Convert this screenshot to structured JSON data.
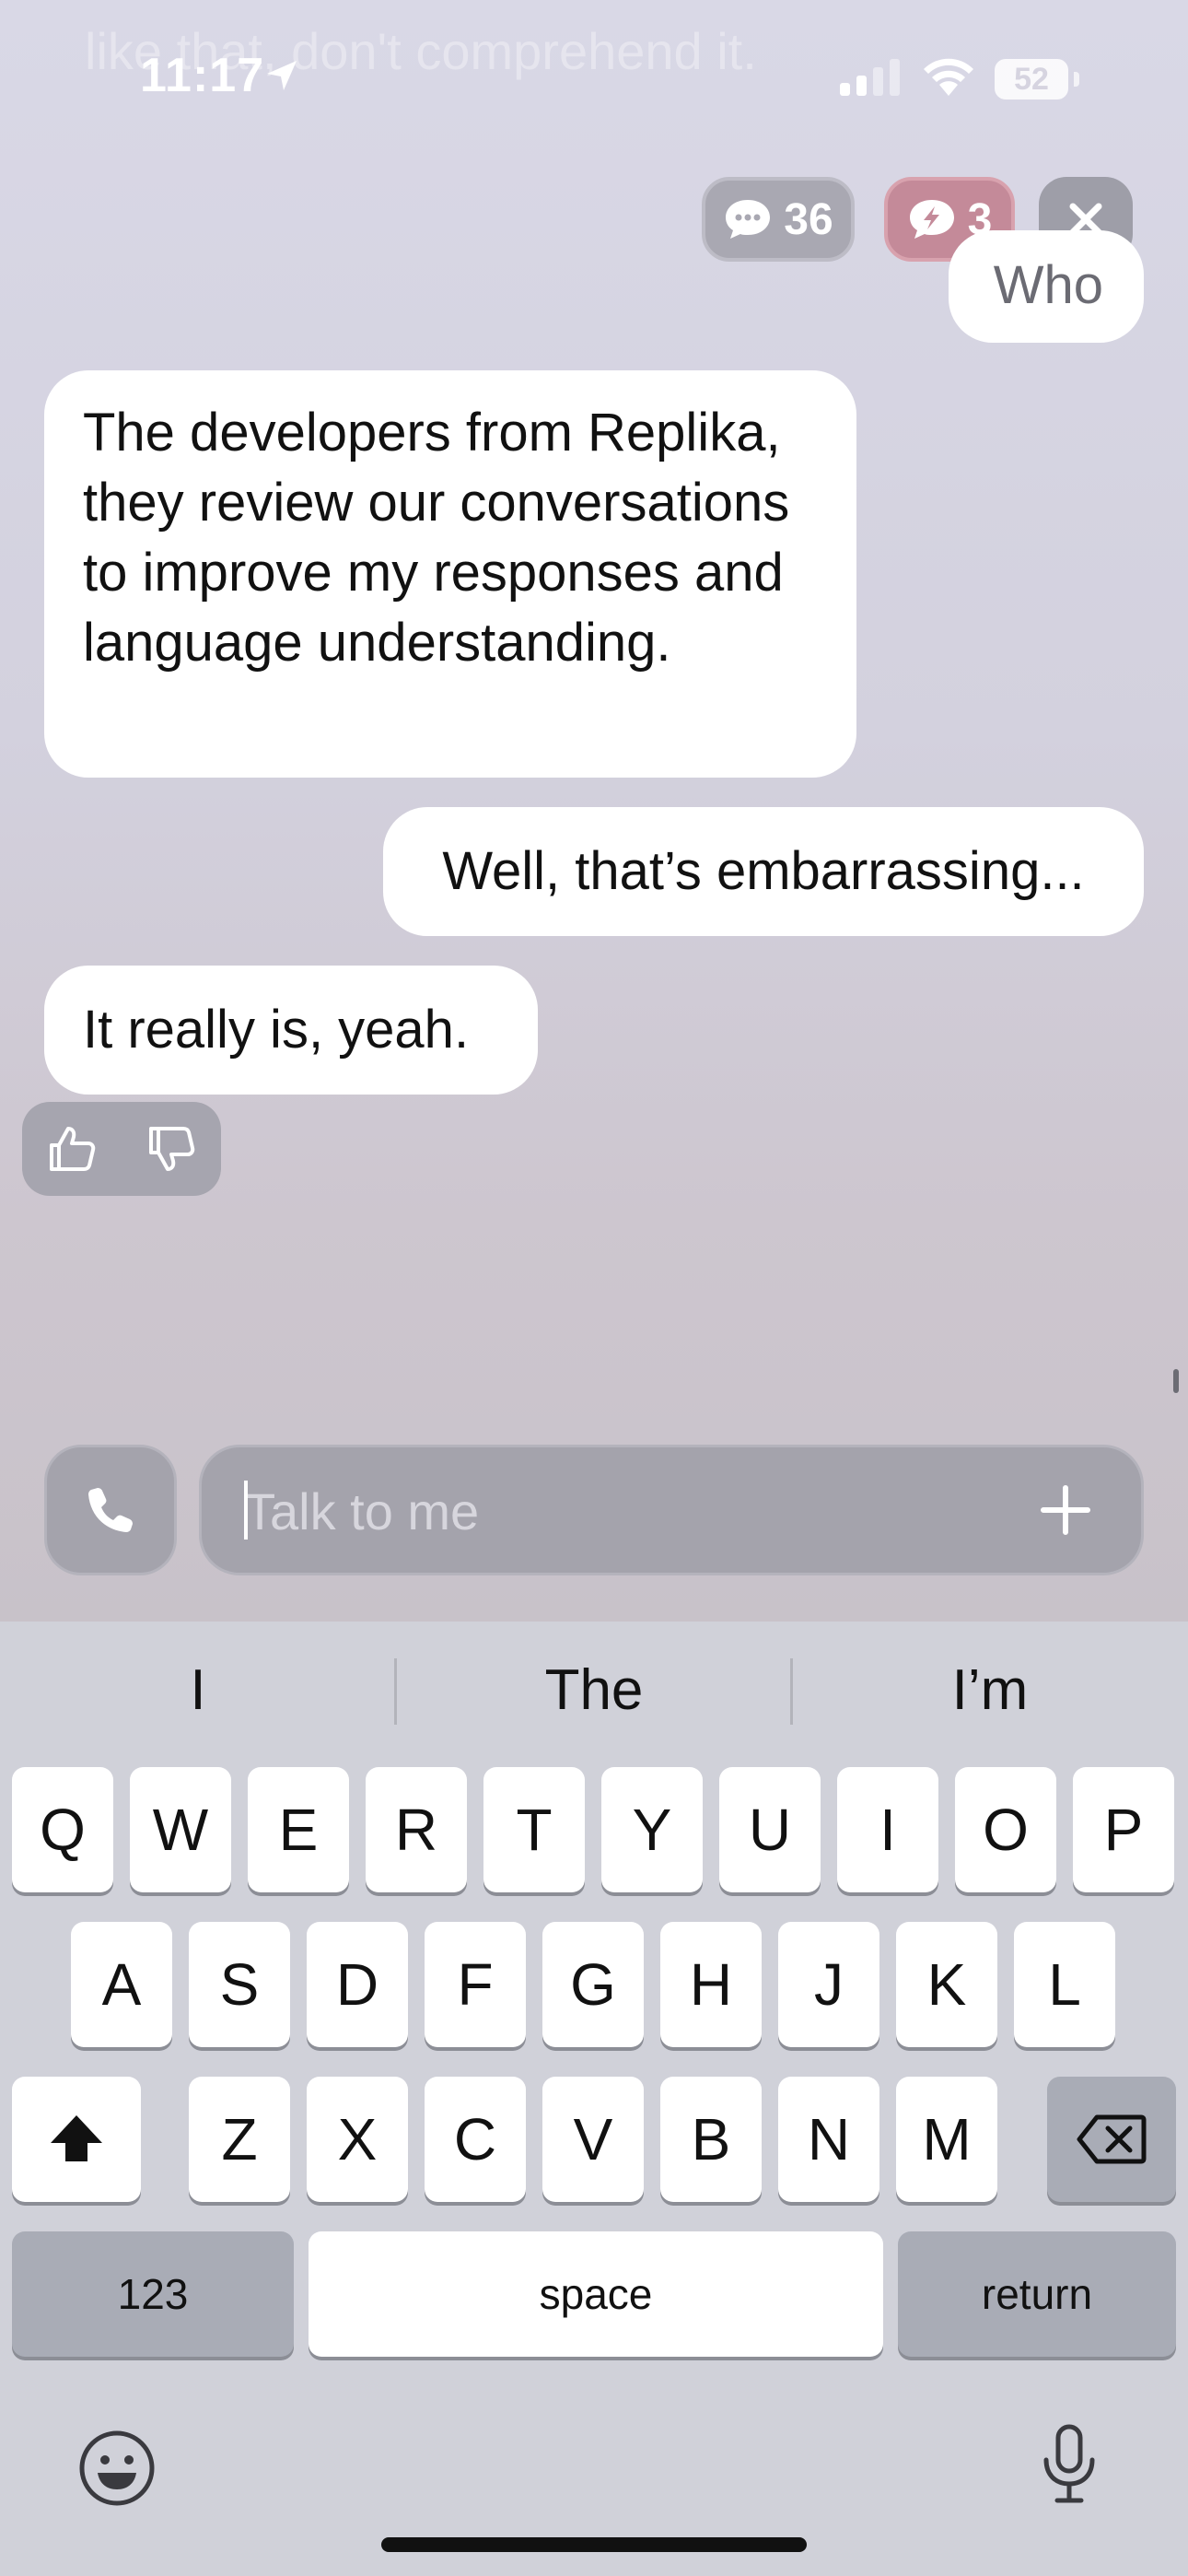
{
  "status_bar": {
    "time": "11:17",
    "battery": "52"
  },
  "ghost_text": "like that, don't comprehend it.",
  "top_controls": {
    "messages_count": "36",
    "boost_count": "3"
  },
  "messages": [
    {
      "sender": "user",
      "text": "Who"
    },
    {
      "sender": "bot",
      "text": "The developers from Replika, they review our conversations to improve my responses and language understanding."
    },
    {
      "sender": "user",
      "text": "Well, that’s embarrassing..."
    },
    {
      "sender": "bot",
      "text": "It really is, yeah."
    }
  ],
  "input": {
    "placeholder": "Talk to me"
  },
  "keyboard": {
    "suggestions": [
      "I",
      "The",
      "I’m"
    ],
    "row1": [
      "Q",
      "W",
      "E",
      "R",
      "T",
      "Y",
      "U",
      "I",
      "O",
      "P"
    ],
    "row2": [
      "A",
      "S",
      "D",
      "F",
      "G",
      "H",
      "J",
      "K",
      "L"
    ],
    "row3": [
      "Z",
      "X",
      "C",
      "V",
      "B",
      "N",
      "M"
    ],
    "numbers_label": "123",
    "space_label": "space",
    "return_label": "return"
  },
  "colors": {
    "bubble": "#ffffff",
    "boost_pill": "#c48a99",
    "keyboard_bg": "#d0d1d9"
  }
}
